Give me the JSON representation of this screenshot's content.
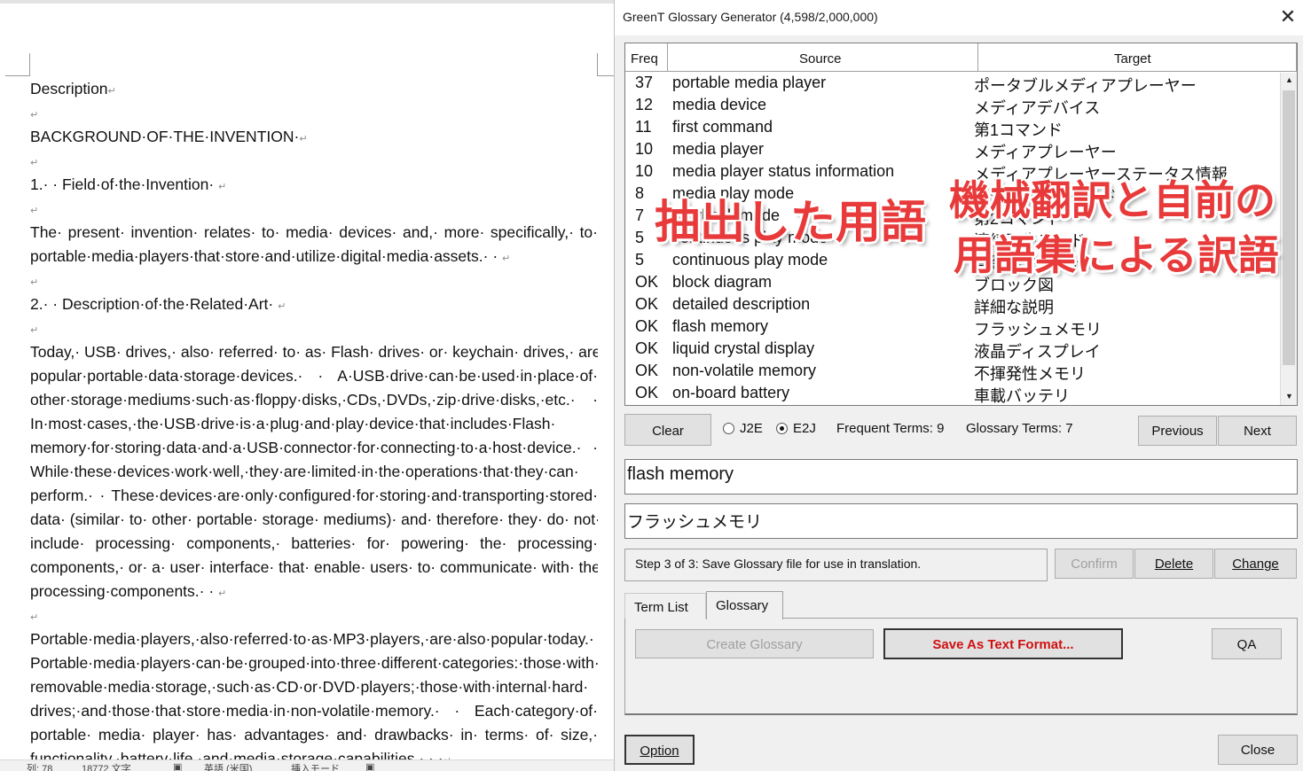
{
  "document": {
    "lines": [
      {
        "text": "Description",
        "pm": "↵",
        "just": false
      },
      {
        "text": "",
        "pm": "↵",
        "just": false
      },
      {
        "text": "BACKGROUND·OF·THE·INVENTION·",
        "pm": "↵",
        "just": false
      },
      {
        "text": "",
        "pm": "↵",
        "just": false
      },
      {
        "text": "1.· · Field·of·the·Invention· ",
        "pm": "↵",
        "just": false
      },
      {
        "text": "",
        "pm": "↵",
        "just": false
      },
      {
        "text": "The· present· invention· relates· to· media· devices· and,· more· specifically,· to·",
        "pm": "",
        "just": true
      },
      {
        "text": "portable·media·players·that·store·and·utilize·digital·media·assets.· · ",
        "pm": "↵",
        "just": false
      },
      {
        "text": "",
        "pm": "↵",
        "just": false
      },
      {
        "text": "2.· · Description·of·the·Related·Art· ",
        "pm": "↵",
        "just": false
      },
      {
        "text": "",
        "pm": "↵",
        "just": false
      },
      {
        "text": "Today,· USB· drives,· also· referred· to· as· Flash· drives· or· keychain· drives,· are·",
        "pm": "",
        "just": true
      },
      {
        "text": "popular·portable·data·storage·devices.· · A·USB·drive·can·be·used·in·place·of·",
        "pm": "",
        "just": true
      },
      {
        "text": "other·storage·mediums·such·as·floppy·disks,·CDs,·DVDs,·zip·drive·disks,·etc.· ·",
        "pm": "",
        "just": true
      },
      {
        "text": "In·most·cases,·the·USB·drive·is·a·plug·and·play·device·that·includes·Flash·",
        "pm": "",
        "just": true
      },
      {
        "text": "memory·for·storing·data·and·a·USB·connector·for·connecting·to·a·host·device.· ·",
        "pm": "",
        "just": true
      },
      {
        "text": "While·these·devices·work·well,·they·are·limited·in·the·operations·that·they·can·",
        "pm": "",
        "just": true
      },
      {
        "text": "perform.· · These·devices·are·only·configured·for·storing·and·transporting·stored·",
        "pm": "",
        "just": true
      },
      {
        "text": "data· (similar· to· other· portable· storage· mediums)· and· therefore· they· do· not·",
        "pm": "",
        "just": true
      },
      {
        "text": "include· processing· components,· batteries· for· powering· the· processing·",
        "pm": "",
        "just": true
      },
      {
        "text": "components,· or· a· user· interface· that· enable· users· to· communicate· with· the·",
        "pm": "",
        "just": true
      },
      {
        "text": "processing·components.· · ",
        "pm": "↵",
        "just": false
      },
      {
        "text": "",
        "pm": "↵",
        "just": false
      },
      {
        "text": "Portable·media·players,·also·referred·to·as·MP3·players,·are·also·popular·today.· ·",
        "pm": "",
        "just": true
      },
      {
        "text": "Portable·media·players·can·be·grouped·into·three·different·categories:·those·with·",
        "pm": "",
        "just": true
      },
      {
        "text": "removable·media·storage,·such·as·CD·or·DVD·players;·those·with·internal·hard·",
        "pm": "",
        "just": true
      },
      {
        "text": "drives;·and·those·that·store·media·in·non-volatile·memory.· · Each·category·of·",
        "pm": "",
        "just": true
      },
      {
        "text": "portable· media· player· has· advantages· and· drawbacks· in· terms· of· size,·",
        "pm": "",
        "just": true
      },
      {
        "text": "functionality,·battery·life,·and·media·storage·capabilities.· · ·",
        "pm": "↵",
        "just": false
      }
    ],
    "status_bar": {
      "col": "列: 78",
      "chars": "18772 文字",
      "lang": "英語 (米国)",
      "mode": "挿入モード"
    }
  },
  "dialog": {
    "title": "GreenT Glossary Generator (4,598/2,000,000)",
    "close_glyph": "✕",
    "columns": {
      "freq": "Freq",
      "source": "Source",
      "target": "Target"
    },
    "rows": [
      {
        "freq": "37",
        "source": "portable media player",
        "target": "ポータブルメディアプレーヤー"
      },
      {
        "freq": "12",
        "source": "media device",
        "target": "メディアデバイス"
      },
      {
        "freq": "11",
        "source": "first command",
        "target": "第1コマンド"
      },
      {
        "freq": "10",
        "source": "media player",
        "target": "メディアプレーヤー"
      },
      {
        "freq": "10",
        "source": "media player status information",
        "target": "メディアプレーヤーステータス情報"
      },
      {
        "freq": "8",
        "source": "media play mode",
        "target": "メディア再生モード"
      },
      {
        "freq": "7",
        "source": "playback mode",
        "target": "第2コマンド"
      },
      {
        "freq": "5",
        "source": "continuous play mode",
        "target": "連続再生モード"
      },
      {
        "freq": "5",
        "source": "continuous play mode",
        "target": "連続再生モード"
      },
      {
        "freq": "OK",
        "source": "block diagram",
        "target": "ブロック図"
      },
      {
        "freq": "OK",
        "source": "detailed description",
        "target": "詳細な説明"
      },
      {
        "freq": "OK",
        "source": "flash memory",
        "target": "フラッシュメモリ"
      },
      {
        "freq": "OK",
        "source": "liquid crystal display",
        "target": "液晶ディスプレイ"
      },
      {
        "freq": "OK",
        "source": "non-volatile memory",
        "target": "不揮発性メモリ"
      },
      {
        "freq": "OK",
        "source": "on-board battery",
        "target": "車載バッテリ"
      }
    ],
    "clear_label": "Clear",
    "radio_j2e": "J2E",
    "radio_e2j": "E2J",
    "frequent_terms": "Frequent Terms: 9",
    "glossary_terms": "Glossary Terms: 7",
    "previous_label": "Previous",
    "next_label": "Next",
    "source_value": "flash memory",
    "target_value": "フラッシュメモリ",
    "status_text": "Step 3 of 3: Save Glossary file for use in translation.",
    "confirm_label": "Confirm",
    "delete_label": "Delete",
    "change_label": "Change",
    "tab_term_list": "Term List",
    "tab_glossary": "Glossary",
    "create_glossary_label": "Create Glossary",
    "save_text_label": "Save As Text Format...",
    "qa_label": "QA",
    "option_label": "Option",
    "close_label": "Close"
  },
  "overlays": {
    "extracted_terms": "抽出した用語",
    "translation_line1": "機械翻訳と自前の",
    "translation_line2": "用語集による訳語"
  },
  "colors": {
    "overlay": "#e83a3a",
    "save_button_text": "#d01010"
  }
}
